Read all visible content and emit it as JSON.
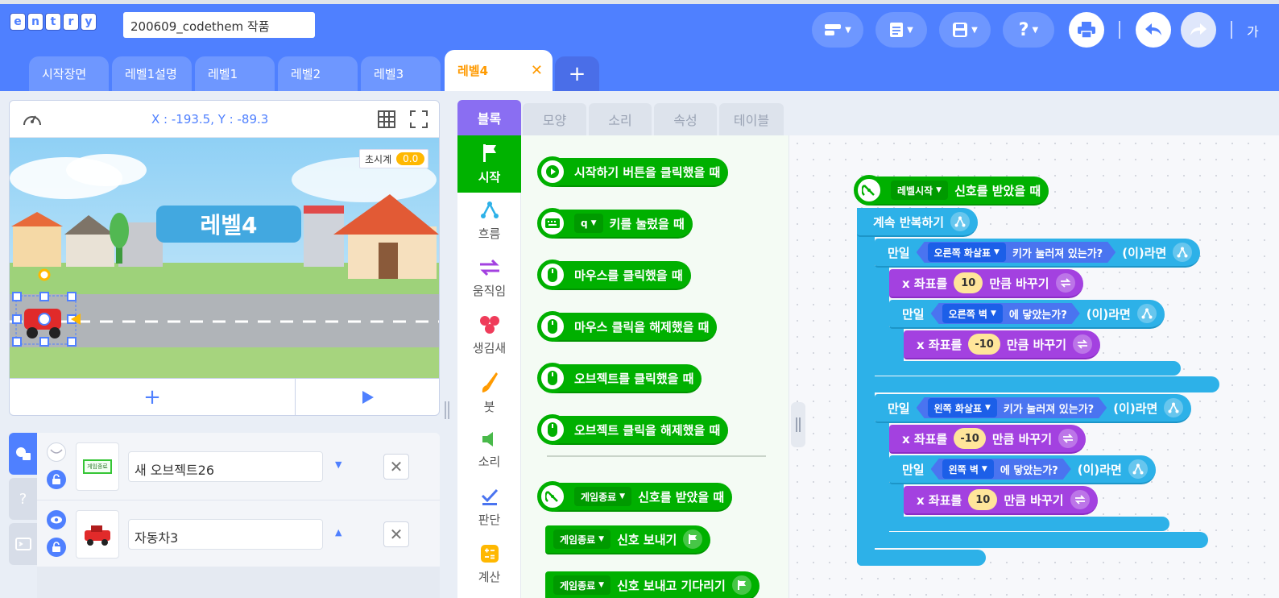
{
  "app": {
    "logo_letters": [
      "e",
      "n",
      "t",
      "r",
      "y"
    ],
    "project_title": "200609_codethem 작품",
    "cut_off_label": "가"
  },
  "scene_tabs": [
    {
      "label": "시작장면"
    },
    {
      "label": "레벨1설명"
    },
    {
      "label": "레벨1"
    },
    {
      "label": "레벨2"
    },
    {
      "label": "레벨3"
    },
    {
      "label": "레벨4",
      "active": true
    }
  ],
  "stage": {
    "coords": "X : -193.5,  Y : -89.3",
    "timer_label": "초시계",
    "timer_value": "0.0",
    "banner_text": "레벨4"
  },
  "objects": [
    {
      "name": "새 오브젝트26",
      "thumb_text": "게임종료",
      "visible": false
    },
    {
      "name": "자동차3",
      "visible": true
    }
  ],
  "block_tabs": [
    "블록",
    "모양",
    "소리",
    "속성",
    "테이블"
  ],
  "categories": [
    {
      "label": "시작",
      "icon": "flag-icon",
      "color": "#00b200"
    },
    {
      "label": "흐름",
      "icon": "flow-icon",
      "color": "#2db1e8"
    },
    {
      "label": "움직임",
      "icon": "move-arrows-icon",
      "color": "#a341e0"
    },
    {
      "label": "생김새",
      "icon": "looks-icon",
      "color": "#ef3c5a"
    },
    {
      "label": "붓",
      "icon": "brush-icon",
      "color": "#ff9a00"
    },
    {
      "label": "소리",
      "icon": "speaker-icon",
      "color": "#49b94a"
    },
    {
      "label": "판단",
      "icon": "check-icon",
      "color": "#4a74f0"
    },
    {
      "label": "계산",
      "icon": "calc-icon",
      "color": "#ffb800"
    }
  ],
  "palette": {
    "start_click": "시작하기 버튼을 클릭했을 때",
    "key_value": "q",
    "key_pressed": "키를 눌렀을 때",
    "mouse_click": "마우스를 클릭했을 때",
    "mouse_release": "마우스 클릭을 해제했을 때",
    "object_click": "오브젝트를 클릭했을 때",
    "object_release": "오브젝트 클릭을 해제했을 때",
    "signal_name": "게임종료",
    "signal_received": "신호를 받았을 때",
    "signal_send": "신호 보내기",
    "signal_send_wait": "신호 보내고 기다리기"
  },
  "script": {
    "hat_signal": "레벨시작",
    "hat_text": "신호를 받았을 때",
    "loop": "계속 반복하기",
    "if_word": "만일",
    "then_word": "(이)라면",
    "if1_key": "오른쪽 화살표",
    "key_pressed_q": "키가 눌러져 있는가?",
    "change_x": "x 좌표를",
    "by_word": "만큼 바꾸기",
    "val_10": "10",
    "val_neg10": "-10",
    "if2_obj": "오른쪽 벽",
    "touching": "에 닿았는가?",
    "if3_key": "왼쪽 화살표",
    "if4_obj": "왼쪽 벽"
  },
  "colors": {
    "brand": "#4f80ff",
    "start_green": "#00b000",
    "flow_blue": "#2db1e8",
    "move_purple": "#a341e0",
    "active_tab": "#ff9a00",
    "block_tab_active": "#8a6ef2"
  }
}
